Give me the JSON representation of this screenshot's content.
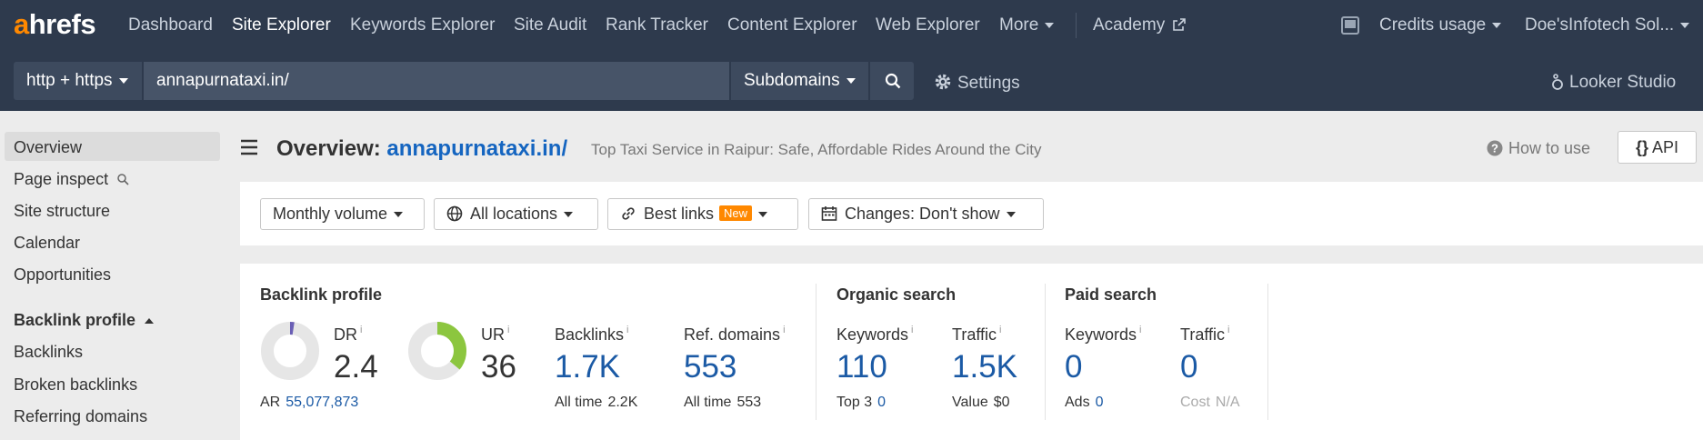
{
  "nav": {
    "logo_a": "a",
    "logo_rest": "hrefs",
    "items": [
      "Dashboard",
      "Site Explorer",
      "Keywords Explorer",
      "Site Audit",
      "Rank Tracker",
      "Content Explorer",
      "Web Explorer",
      "More"
    ],
    "academy": "Academy",
    "credits": "Credits usage",
    "account": "Doe'sInfotech Sol..."
  },
  "search": {
    "protocol": "http + https",
    "url": "annapurnataxi.in/",
    "mode": "Subdomains",
    "settings": "Settings",
    "looker": "Looker Studio"
  },
  "sidebar": {
    "items": [
      "Overview",
      "Page inspect",
      "Site structure",
      "Calendar",
      "Opportunities"
    ],
    "section": "Backlink profile",
    "section_items": [
      "Backlinks",
      "Broken backlinks",
      "Referring domains"
    ]
  },
  "header": {
    "title_prefix": "Overview:",
    "site": "annapurnataxi.in/",
    "description": "Top Taxi Service in Raipur: Safe, Affordable Rides Around the City",
    "how_to": "How to use",
    "api": "API"
  },
  "filters": {
    "volume": "Monthly volume",
    "locations": "All locations",
    "links": "Best links",
    "links_badge": "New",
    "changes": "Changes: Don't show"
  },
  "metrics": {
    "backlink_profile": {
      "title": "Backlink profile",
      "dr_label": "DR",
      "dr_value": "2.4",
      "dr_fraction": 0.024,
      "ar_label": "AR",
      "ar_value": "55,077,873",
      "ur_label": "UR",
      "ur_value": "36",
      "ur_fraction": 0.36,
      "backlinks_label": "Backlinks",
      "backlinks_value": "1.7K",
      "backlinks_alltime_label": "All time",
      "backlinks_alltime": "2.2K",
      "refdomains_label": "Ref. domains",
      "refdomains_value": "553",
      "refdomains_alltime_label": "All time",
      "refdomains_alltime": "553"
    },
    "organic": {
      "title": "Organic search",
      "keywords_label": "Keywords",
      "keywords_value": "110",
      "top3_label": "Top 3",
      "top3_value": "0",
      "traffic_label": "Traffic",
      "traffic_value": "1.5K",
      "value_label": "Value",
      "value_value": "$0"
    },
    "paid": {
      "title": "Paid search",
      "keywords_label": "Keywords",
      "keywords_value": "0",
      "ads_label": "Ads",
      "ads_value": "0",
      "traffic_label": "Traffic",
      "traffic_value": "0",
      "cost_label": "Cost",
      "cost_value": "N/A"
    }
  },
  "colors": {
    "nav_bg": "#2e3a4d",
    "accent_orange": "#ff8800",
    "link_blue": "#1b5aa5",
    "dr_arc": "#6a5fb5",
    "ur_arc": "#8cc63f"
  },
  "icons": [
    "external-link-icon",
    "clear-icon",
    "search-icon",
    "gear-icon",
    "looker-icon",
    "hamburger-icon",
    "help-icon",
    "globe-icon",
    "link-icon",
    "calendar-icon",
    "monitor-icon",
    "magnifier-icon",
    "caret-up-icon"
  ]
}
